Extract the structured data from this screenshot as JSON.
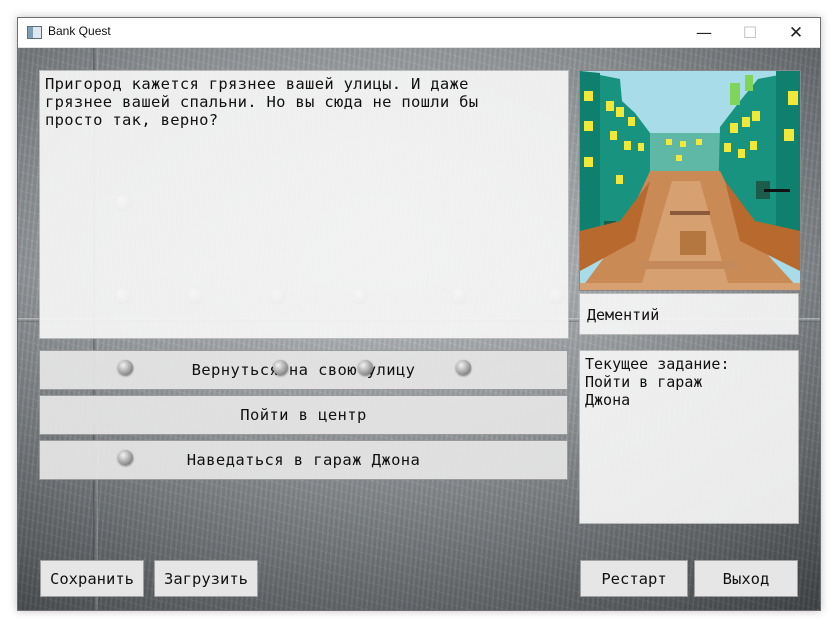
{
  "window": {
    "title": "Bank Quest",
    "controls": {
      "minimize": "—",
      "maximize": "☐",
      "close": "✕"
    }
  },
  "story": {
    "text": "Пригород кажется грязнее вашей улицы. И даже\nгрязнее вашей спальни. Но вы сюда не пошли бы\nпросто так, верно?"
  },
  "portrait": {
    "scene": "pixel-art-suburb-street"
  },
  "character": {
    "name": "Дементий"
  },
  "quest": {
    "text": "Текущее задание:\nПойти в гараж\nДжона"
  },
  "choices": [
    {
      "label": "Вернуться на свою улицу"
    },
    {
      "label": "Пойти в центр"
    },
    {
      "label": "Наведаться в гараж Джона"
    }
  ],
  "buttons": {
    "save": "Сохранить",
    "load": "Загрузить",
    "restart": "Рестарт",
    "exit": "Выход"
  },
  "colors": {
    "sky": "#a8dce8",
    "building": "#1a9a86",
    "window": "#f2e83a",
    "road": "#c98a55"
  }
}
